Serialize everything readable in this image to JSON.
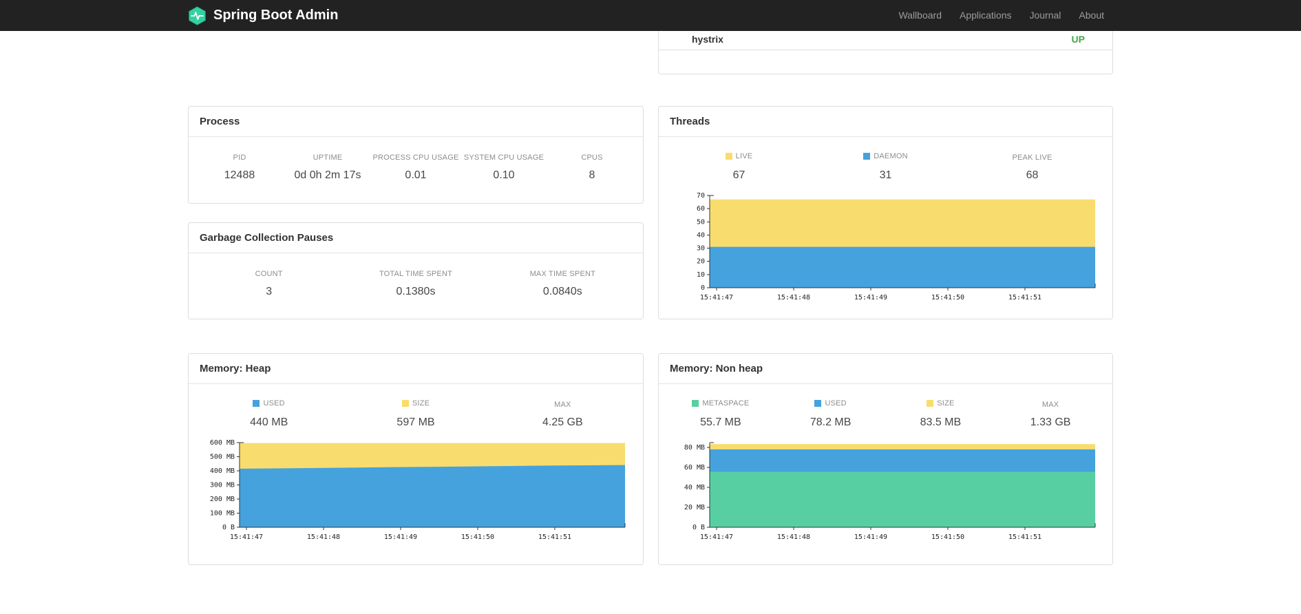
{
  "navbar": {
    "brand": "Spring Boot Admin",
    "items": [
      {
        "label": "Wallboard"
      },
      {
        "label": "Applications"
      },
      {
        "label": "Journal"
      },
      {
        "label": "About"
      }
    ]
  },
  "colors": {
    "status_up": "#47a447",
    "blue": "#45a2dd",
    "yellow": "#f8dd6e",
    "green": "#58cfa2"
  },
  "applications_panel": {
    "app_name": "hystrix",
    "status": "UP"
  },
  "process": {
    "title": "Process",
    "metrics": [
      {
        "label": "PID",
        "value": "12488"
      },
      {
        "label": "UPTIME",
        "value": "0d 0h 2m 17s"
      },
      {
        "label": "PROCESS CPU USAGE",
        "value": "0.01"
      },
      {
        "label": "SYSTEM CPU USAGE",
        "value": "0.10"
      },
      {
        "label": "CPUS",
        "value": "8"
      }
    ]
  },
  "gc": {
    "title": "Garbage Collection Pauses",
    "metrics": [
      {
        "label": "COUNT",
        "value": "3"
      },
      {
        "label": "TOTAL TIME SPENT",
        "value": "0.1380s"
      },
      {
        "label": "MAX TIME SPENT",
        "value": "0.0840s"
      }
    ]
  },
  "threads": {
    "title": "Threads",
    "metrics": [
      {
        "label": "LIVE",
        "value": "67",
        "color": "#f8dd6e"
      },
      {
        "label": "DAEMON",
        "value": "31",
        "color": "#45a2dd"
      },
      {
        "label": "PEAK LIVE",
        "value": "68"
      }
    ]
  },
  "heap": {
    "title": "Memory: Heap",
    "metrics": [
      {
        "label": "USED",
        "value": "440 MB",
        "color": "#45a2dd"
      },
      {
        "label": "SIZE",
        "value": "597 MB",
        "color": "#f8dd6e"
      },
      {
        "label": "MAX",
        "value": "4.25 GB"
      }
    ]
  },
  "nonheap": {
    "title": "Memory: Non heap",
    "metrics": [
      {
        "label": "METASPACE",
        "value": "55.7 MB",
        "color": "#58cfa2"
      },
      {
        "label": "USED",
        "value": "78.2 MB",
        "color": "#45a2dd"
      },
      {
        "label": "SIZE",
        "value": "83.5 MB",
        "color": "#f8dd6e"
      },
      {
        "label": "MAX",
        "value": "1.33 GB"
      }
    ]
  },
  "chart_data": [
    {
      "id": "threads",
      "type": "area",
      "title": "Threads",
      "x_labels": [
        "15:41:47",
        "15:41:48",
        "15:41:49",
        "15:41:50",
        "15:41:51"
      ],
      "ylim": [
        0,
        70
      ],
      "yticks": [
        {
          "v": 70,
          "label": "70"
        },
        {
          "v": 60,
          "label": "60"
        },
        {
          "v": 50,
          "label": "50"
        },
        {
          "v": 40,
          "label": "40"
        },
        {
          "v": 30,
          "label": "30"
        },
        {
          "v": 20,
          "label": "20"
        },
        {
          "v": 10,
          "label": "10"
        },
        {
          "v": 0,
          "label": "0"
        }
      ],
      "series": [
        {
          "name": "LIVE",
          "color": "#f8dd6e",
          "values": [
            67,
            67,
            67,
            67,
            67,
            67
          ]
        },
        {
          "name": "DAEMON",
          "color": "#45a2dd",
          "values": [
            31,
            31,
            31,
            31,
            31,
            31
          ]
        }
      ]
    },
    {
      "id": "heap",
      "type": "area",
      "title": "Memory: Heap (MB)",
      "x_labels": [
        "15:41:47",
        "15:41:48",
        "15:41:49",
        "15:41:50",
        "15:41:51"
      ],
      "ylim": [
        0,
        600
      ],
      "yticks": [
        {
          "v": 600,
          "label": "600 MB"
        },
        {
          "v": 500,
          "label": "500 MB"
        },
        {
          "v": 400,
          "label": "400 MB"
        },
        {
          "v": 300,
          "label": "300 MB"
        },
        {
          "v": 200,
          "label": "200 MB"
        },
        {
          "v": 100,
          "label": "100 MB"
        },
        {
          "v": 0,
          "label": "0 B"
        }
      ],
      "series": [
        {
          "name": "SIZE",
          "color": "#f8dd6e",
          "values": [
            597,
            597,
            597,
            597,
            597,
            597
          ]
        },
        {
          "name": "USED",
          "color": "#45a2dd",
          "values": [
            415,
            420,
            426,
            431,
            437,
            441
          ]
        }
      ]
    },
    {
      "id": "nonheap",
      "type": "area",
      "title": "Memory: Non heap (MB)",
      "x_labels": [
        "15:41:47",
        "15:41:48",
        "15:41:49",
        "15:41:50",
        "15:41:51"
      ],
      "ylim": [
        0,
        85
      ],
      "yticks": [
        {
          "v": 80,
          "label": "80 MB"
        },
        {
          "v": 60,
          "label": "60 MB"
        },
        {
          "v": 40,
          "label": "40 MB"
        },
        {
          "v": 20,
          "label": "20 MB"
        },
        {
          "v": 0,
          "label": "0 B"
        }
      ],
      "series": [
        {
          "name": "SIZE",
          "color": "#f8dd6e",
          "values": [
            83.5,
            83.5,
            83.5,
            83.5,
            83.5,
            83.5
          ]
        },
        {
          "name": "USED",
          "color": "#45a2dd",
          "values": [
            78.2,
            78.2,
            78.2,
            78.2,
            78.2,
            78.2
          ]
        },
        {
          "name": "METASPACE",
          "color": "#58cfa2",
          "values": [
            55.7,
            55.7,
            55.7,
            55.7,
            55.7,
            55.7
          ]
        }
      ]
    }
  ]
}
